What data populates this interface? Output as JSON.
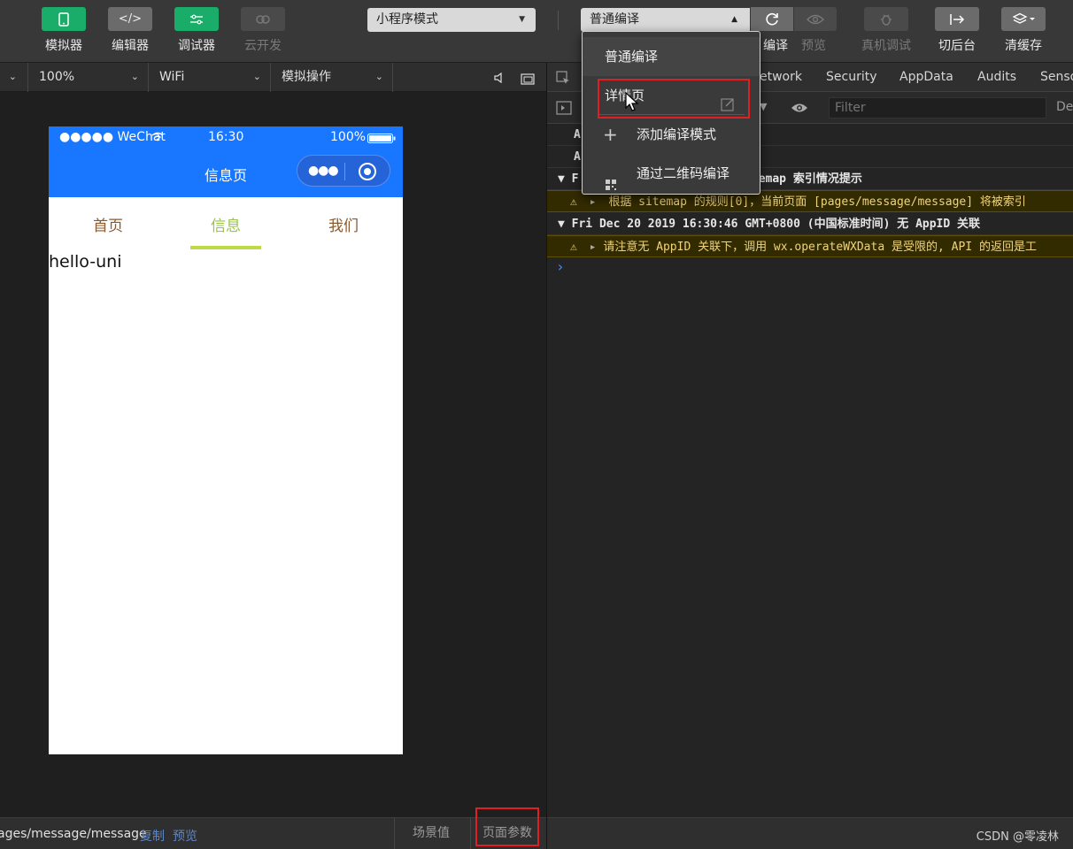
{
  "toolbar": {
    "simulator": "模拟器",
    "editor": "编辑器",
    "debugger": "调试器",
    "cloud": "云开发",
    "mode_select": "小程序模式",
    "compile_select": "普通编译",
    "compile_label": "编译",
    "preview": "预览",
    "remote_debug": "真机调试",
    "background": "切后台",
    "clear_cache": "清缓存"
  },
  "simbar": {
    "zoom": "100%",
    "network": "WiFi",
    "simulate": "模拟操作"
  },
  "phone": {
    "status": {
      "signal": "●●●●● WeChat",
      "time": "16:30",
      "battery": "100%"
    },
    "nav_title": "信息页",
    "tabs": [
      "首页",
      "信息",
      "我们"
    ],
    "active_tab_index": 1,
    "content_text": "hello-uni"
  },
  "leftfoot": {
    "path": "ages/message/message",
    "copy": "复制",
    "preview": "预览",
    "scene": "场景值",
    "page_params": "页面参数"
  },
  "devtools": {
    "tabs": [
      "etwork",
      "Security",
      "AppData",
      "Audits",
      "Senso"
    ],
    "filter_placeholder": "Filter",
    "right_label": "Def",
    "rows": [
      {
        "type": "plain",
        "text": "A"
      },
      {
        "type": "plain",
        "text": "A"
      },
      {
        "type": "grp",
        "text": "▼ F                    GMT+0800 (中国标准时间) sitemap 索引情况提示"
      },
      {
        "type": "warn",
        "text": "根据 sitemap 的规则[0]，当前页面 [pages/message/message] 将被索引"
      },
      {
        "type": "grp",
        "text": "▼ Fri Dec 20 2019 16:30:46 GMT+0800 (中国标准时间) 无 AppID 关联"
      },
      {
        "type": "warn",
        "text": "请注意无 AppID 关联下，调用 wx.operateWXData 是受限的, API 的返回是工"
      }
    ],
    "prompt": "›"
  },
  "menu": {
    "items": [
      "普通编译",
      "详情页",
      "添加编译模式",
      "通过二维码编译"
    ]
  },
  "credit": "CSDN @零凌林",
  "colors": {
    "accent_blue": "#1976ff",
    "active_tab": "#9bc24a",
    "highlight_red": "#e02020"
  }
}
